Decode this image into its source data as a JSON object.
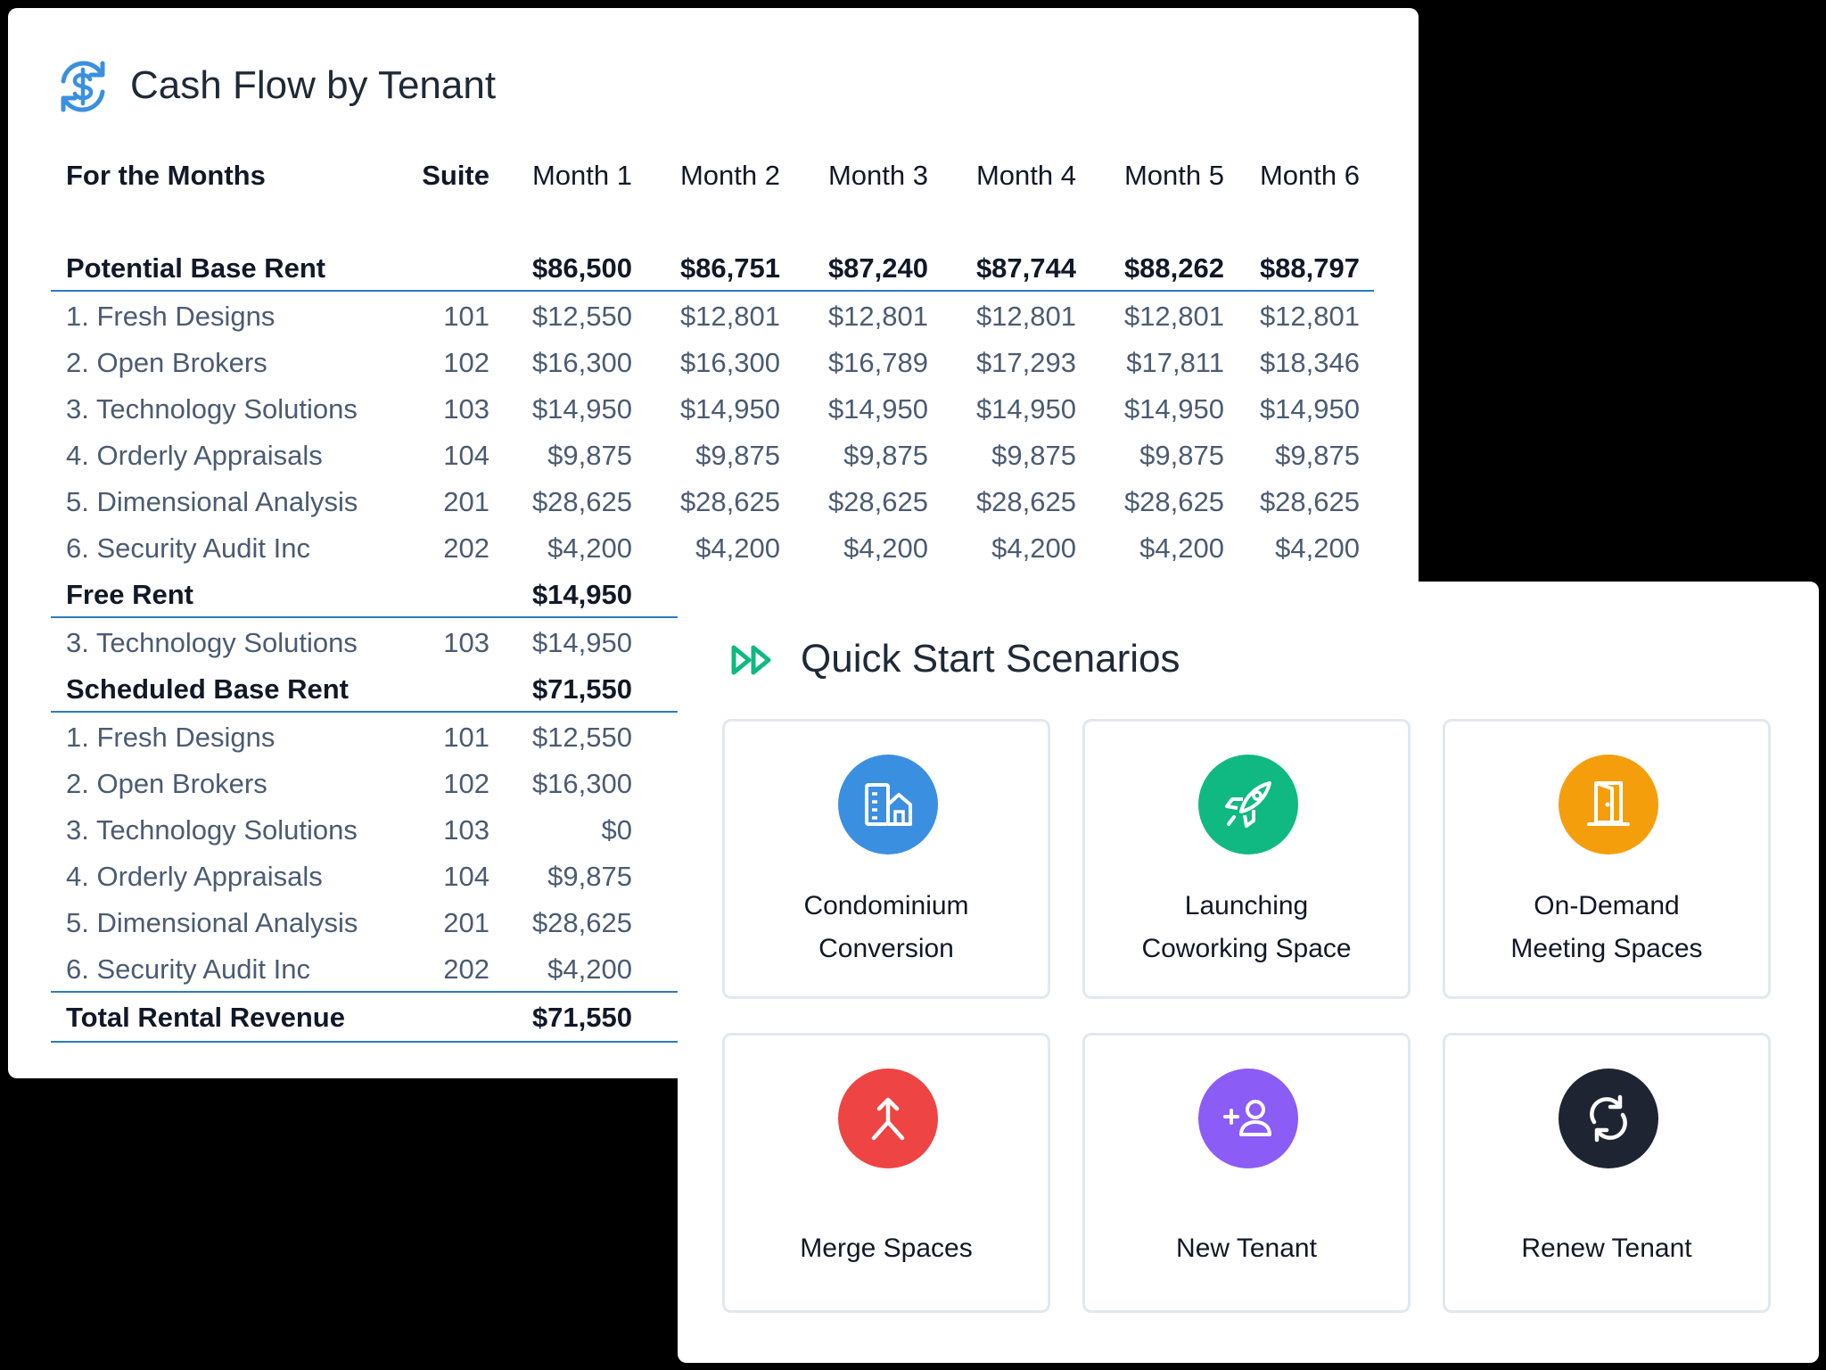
{
  "cash_flow": {
    "title": "Cash Flow by Tenant",
    "icon": "dollar-cycle-icon",
    "accent_color": "#2c7bc0",
    "header": {
      "label": "For the Months",
      "suite": "Suite",
      "months": [
        "Month 1",
        "Month 2",
        "Month 3",
        "Month 4",
        "Month 5",
        "Month 6"
      ]
    },
    "sections": [
      {
        "label": "Potential Base Rent",
        "totals": [
          "$86,500",
          "$86,751",
          "$87,240",
          "$87,744",
          "$88,262",
          "$88,797"
        ],
        "rows": [
          {
            "name": "1. Fresh Designs",
            "suite": "101",
            "values": [
              "$12,550",
              "$12,801",
              "$12,801",
              "$12,801",
              "$12,801",
              "$12,801"
            ]
          },
          {
            "name": "2. Open Brokers",
            "suite": "102",
            "values": [
              "$16,300",
              "$16,300",
              "$16,789",
              "$17,293",
              "$17,811",
              "$18,346"
            ]
          },
          {
            "name": "3. Technology Solutions",
            "suite": "103",
            "values": [
              "$14,950",
              "$14,950",
              "$14,950",
              "$14,950",
              "$14,950",
              "$14,950"
            ]
          },
          {
            "name": "4. Orderly Appraisals",
            "suite": "104",
            "values": [
              "$9,875",
              "$9,875",
              "$9,875",
              "$9,875",
              "$9,875",
              "$9,875"
            ]
          },
          {
            "name": "5. Dimensional Analysis",
            "suite": "201",
            "values": [
              "$28,625",
              "$28,625",
              "$28,625",
              "$28,625",
              "$28,625",
              "$28,625"
            ]
          },
          {
            "name": "6. Security Audit Inc",
            "suite": "202",
            "values": [
              "$4,200",
              "$4,200",
              "$4,200",
              "$4,200",
              "$4,200",
              "$4,200"
            ]
          }
        ]
      },
      {
        "label": "Free Rent",
        "totals": [
          "$14,950"
        ],
        "rows": [
          {
            "name": "3. Technology Solutions",
            "suite": "103",
            "values": [
              "$14,950"
            ]
          }
        ]
      },
      {
        "label": "Scheduled Base Rent",
        "totals": [
          "$71,550"
        ],
        "rows": [
          {
            "name": "1. Fresh Designs",
            "suite": "101",
            "values": [
              "$12,550"
            ]
          },
          {
            "name": "2. Open Brokers",
            "suite": "102",
            "values": [
              "$16,300"
            ]
          },
          {
            "name": "3. Technology Solutions",
            "suite": "103",
            "values": [
              "$0"
            ]
          },
          {
            "name": "4. Orderly Appraisals",
            "suite": "104",
            "values": [
              "$9,875"
            ]
          },
          {
            "name": "5. Dimensional Analysis",
            "suite": "201",
            "values": [
              "$28,625"
            ]
          },
          {
            "name": "6. Security Audit Inc",
            "suite": "202",
            "values": [
              "$4,200"
            ]
          }
        ]
      }
    ],
    "total": {
      "label": "Total Rental Revenue",
      "values": [
        "$71,550"
      ]
    }
  },
  "quick_start": {
    "title": "Quick Start Scenarios",
    "icon": "fast-forward-icon",
    "icon_color": "#10b981",
    "tiles": [
      {
        "lines": [
          "Condominium",
          "Conversion"
        ],
        "icon": "building-icon",
        "color": "#3b8fe0"
      },
      {
        "lines": [
          "Launching",
          "Coworking Space"
        ],
        "icon": "rocket-icon",
        "color": "#10b981"
      },
      {
        "lines": [
          "On-Demand",
          "Meeting Spaces"
        ],
        "icon": "door-icon",
        "color": "#f59e0b"
      },
      {
        "lines": [
          "Merge Spaces"
        ],
        "icon": "merge-icon",
        "color": "#ef4444"
      },
      {
        "lines": [
          "New Tenant"
        ],
        "icon": "add-user-icon",
        "color": "#8b5cf6"
      },
      {
        "lines": [
          "Renew Tenant"
        ],
        "icon": "refresh-icon",
        "color": "#1f2433"
      }
    ]
  }
}
